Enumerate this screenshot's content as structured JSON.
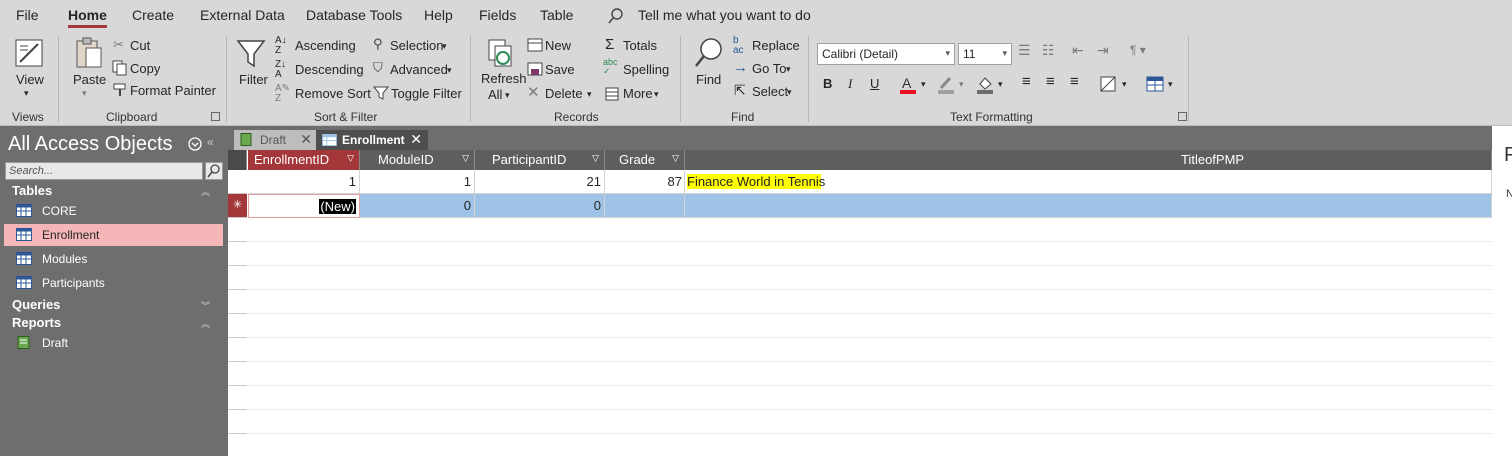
{
  "menubar": {
    "items": [
      "File",
      "Home",
      "Create",
      "External Data",
      "Database Tools",
      "Help",
      "Fields",
      "Table"
    ],
    "tell_me": "Tell me what you want to do"
  },
  "ribbon": {
    "views": {
      "label": "Views",
      "view": "View"
    },
    "clipboard": {
      "label": "Clipboard",
      "paste": "Paste",
      "cut": "Cut",
      "copy": "Copy",
      "format_painter": "Format Painter"
    },
    "sort_filter": {
      "label": "Sort & Filter",
      "filter": "Filter",
      "ascending": "Ascending",
      "descending": "Descending",
      "remove_sort": "Remove Sort",
      "selection": "Selection",
      "advanced": "Advanced",
      "toggle_filter": "Toggle Filter"
    },
    "records": {
      "label": "Records",
      "refresh": "Refresh",
      "refresh2": "All",
      "new": "New",
      "save": "Save",
      "delete": "Delete",
      "totals": "Totals",
      "spelling": "Spelling",
      "more": "More"
    },
    "find": {
      "label": "Find",
      "find": "Find",
      "replace": "Replace",
      "goto": "Go To",
      "select": "Select"
    },
    "text_formatting": {
      "label": "Text Formatting",
      "font": "Calibri (Detail)",
      "size": "11",
      "bold": "B",
      "italic": "I",
      "underline": "U"
    }
  },
  "nav": {
    "title": "All Access Objects",
    "search_placeholder": "Search...",
    "categories": [
      {
        "name": "Tables",
        "items": [
          "CORE",
          "Enrollment",
          "Modules",
          "Participants"
        ]
      },
      {
        "name": "Queries",
        "items": []
      },
      {
        "name": "Reports",
        "items": [
          "Draft"
        ]
      }
    ],
    "selected": "Enrollment"
  },
  "doc_tabs": [
    "Draft",
    "Enrollment"
  ],
  "datasheet": {
    "columns": [
      "EnrollmentID",
      "ModuleID",
      "ParticipantID",
      "Grade",
      "TitleofPMP"
    ],
    "rows": [
      {
        "EnrollmentID": "1",
        "ModuleID": "1",
        "ParticipantID": "21",
        "Grade": "87",
        "TitleofPMP": "Finance World in Tennis"
      }
    ],
    "new_row": {
      "EnrollmentID": "(New)",
      "ModuleID": "0",
      "ParticipantID": "0",
      "Grade": "",
      "TitleofPMP": "",
      "marker": "✳"
    }
  },
  "colors": {
    "accent": "#a4373a",
    "selected_row": "#9ec3e6",
    "nav_selected": "#f4b6b7",
    "highlight": "#ffff00"
  },
  "side_panel": {
    "letter": "P",
    "abbr": "N"
  }
}
